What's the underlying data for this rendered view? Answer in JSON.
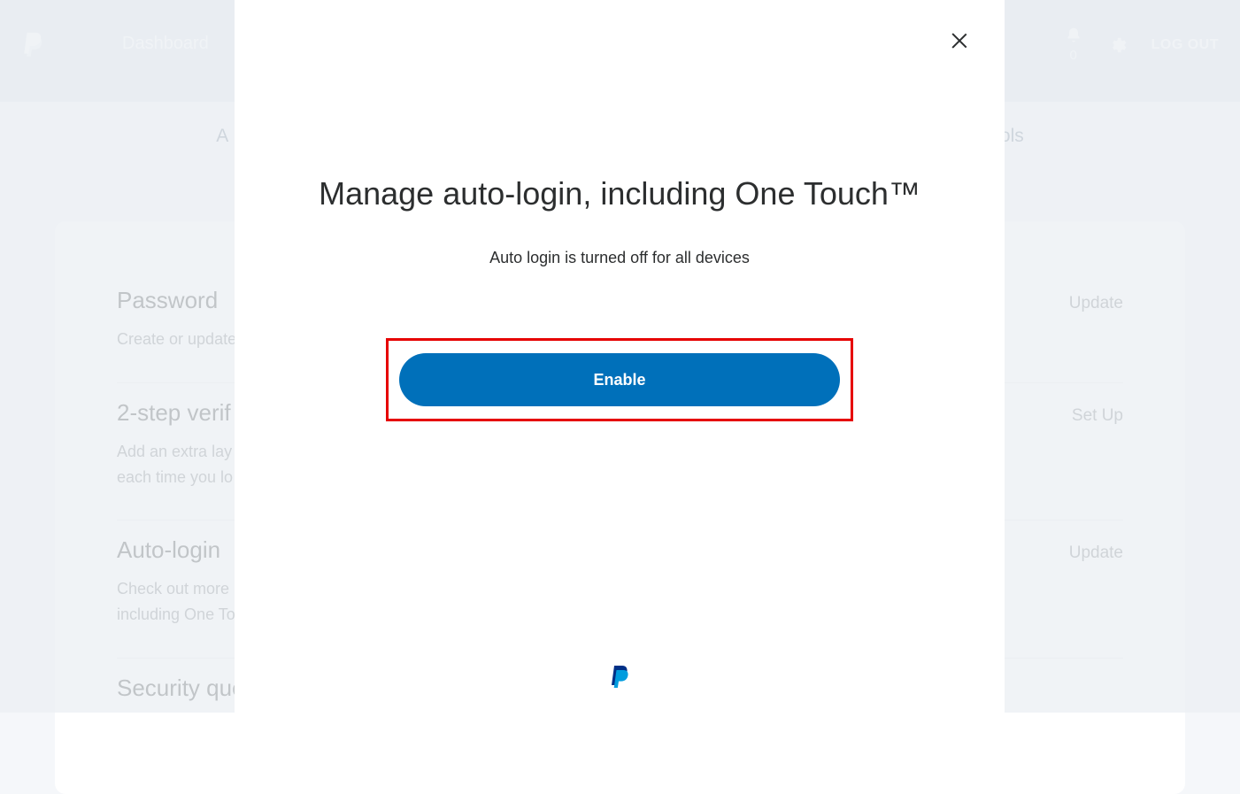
{
  "header": {
    "dashboard": "Dashboard",
    "notification_count": "0",
    "logout": "LOG OUT"
  },
  "tabs": {
    "left": "A",
    "right": "ools"
  },
  "card": {
    "sections": [
      {
        "title": "Password",
        "desc": "Create or update",
        "action": "Update"
      },
      {
        "title": "2-step verif",
        "desc": "Add an extra lay\neach time you lo",
        "action": "Set Up"
      },
      {
        "title": "Auto-login",
        "desc": "Check out more\nincluding One To",
        "action": "Update"
      },
      {
        "title": "Security que",
        "desc": "",
        "action": ""
      }
    ]
  },
  "modal": {
    "title": "Manage auto-login, including One Touch™",
    "subtitle": "Auto login is turned off for all devices",
    "enable": "Enable"
  }
}
